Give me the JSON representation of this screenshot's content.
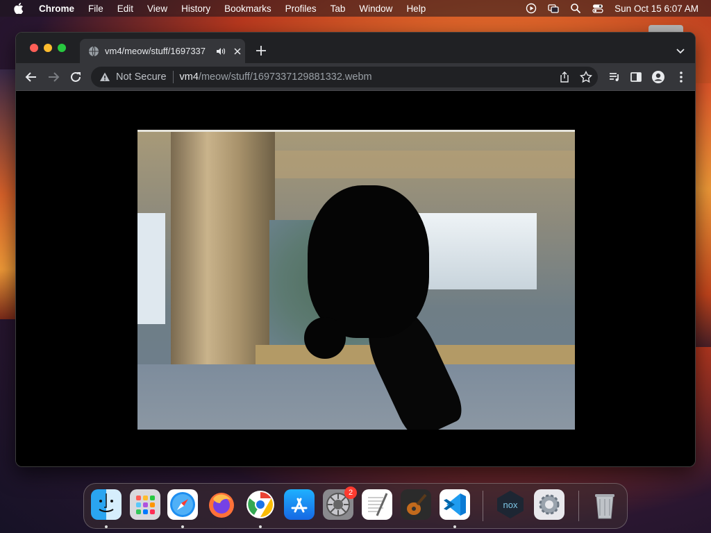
{
  "menubar": {
    "app_name": "Chrome",
    "items": [
      "File",
      "Edit",
      "View",
      "History",
      "Bookmarks",
      "Profiles",
      "Tab",
      "Window",
      "Help"
    ],
    "clock": "Sun Oct 15  6:07 AM"
  },
  "browser": {
    "tab": {
      "title": "vm4/meow/stuff/1697337",
      "favicon": "globe-icon",
      "audio_icon": "speaker-icon"
    },
    "omnibox": {
      "security_label": "Not Secure",
      "host": "vm4",
      "path": "/meow/stuff/1697337129881332.webm"
    }
  },
  "content": {
    "media": "video",
    "description_icon": "video-frame"
  },
  "dock": {
    "apps": [
      "Finder",
      "Launchpad",
      "Safari",
      "Firefox",
      "Chrome",
      "App Store",
      "System Preferences",
      "TextEdit",
      "GarageBand",
      "Visual Studio Code",
      "Nox",
      "Settings",
      "Trash"
    ],
    "system_preferences_badge": "2",
    "nox_label": "nox"
  },
  "colors": {
    "chrome_dark": "#202124",
    "toolbar": "#35363a",
    "close": "#ff5f57",
    "minimize": "#febc2e",
    "zoom": "#28c840",
    "badge": "#ff3b30"
  }
}
